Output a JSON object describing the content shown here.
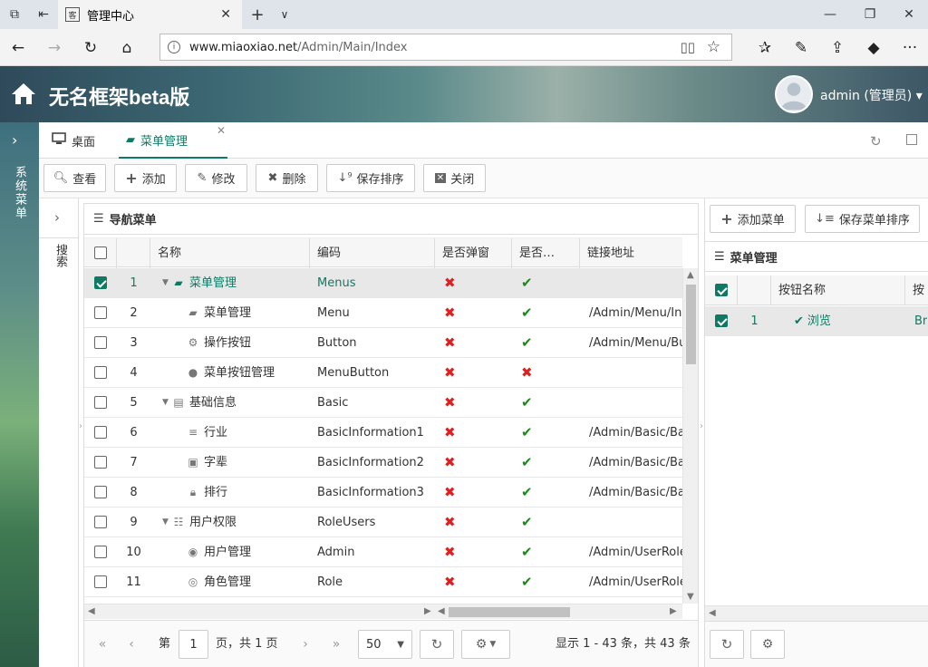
{
  "browser": {
    "tab_title": "管理中心",
    "tab_favicon": "客",
    "url_domain": "www.miaoxiao.net",
    "url_path": "/Admin/Main/Index"
  },
  "app": {
    "title": "无名框架beta版",
    "user": "admin (管理员)"
  },
  "sidebar": {
    "label": "系统菜单"
  },
  "tabs": [
    {
      "label": "桌面"
    },
    {
      "label": "菜单管理"
    }
  ],
  "toolbar": {
    "view": "查看",
    "add": "添加",
    "edit": "修改",
    "delete": "删除",
    "save_order": "保存排序",
    "close": "关闭"
  },
  "search_strip": {
    "label": "搜索"
  },
  "main_panel": {
    "title": "导航菜单",
    "columns": [
      "名称",
      "编码",
      "是否弹窗",
      "是否…",
      "链接地址"
    ],
    "rows": [
      {
        "no": "1",
        "name": "菜单管理",
        "icon": "book-icon",
        "level": 0,
        "expander": true,
        "code": "Menus",
        "popup": false,
        "enabled": true,
        "url": "",
        "selected": true
      },
      {
        "no": "2",
        "name": "菜单管理",
        "icon": "book-icon",
        "level": 1,
        "expander": false,
        "code": "Menu",
        "popup": false,
        "enabled": true,
        "url": "/Admin/Menu/Ind",
        "selected": false
      },
      {
        "no": "3",
        "name": "操作按钮",
        "icon": "cogs-icon",
        "level": 1,
        "expander": false,
        "code": "Button",
        "popup": false,
        "enabled": true,
        "url": "/Admin/Menu/Bu",
        "selected": false
      },
      {
        "no": "4",
        "name": "菜单按钮管理",
        "icon": "user-icon",
        "level": 1,
        "expander": false,
        "code": "MenuButton",
        "popup": false,
        "enabled": false,
        "url": "",
        "selected": false
      },
      {
        "no": "5",
        "name": "基础信息",
        "icon": "list-alt-icon",
        "level": 0,
        "expander": true,
        "code": "Basic",
        "popup": false,
        "enabled": true,
        "url": "",
        "selected": false
      },
      {
        "no": "6",
        "name": "行业",
        "icon": "reorder-icon",
        "level": 1,
        "expander": false,
        "code": "BasicInformation1",
        "popup": false,
        "enabled": true,
        "url": "/Admin/Basic/Ba",
        "selected": false
      },
      {
        "no": "7",
        "name": "字辈",
        "icon": "suitcase-icon",
        "level": 1,
        "expander": false,
        "code": "BasicInformation2",
        "popup": false,
        "enabled": true,
        "url": "/Admin/Basic/Ba",
        "selected": false
      },
      {
        "no": "8",
        "name": "排行",
        "icon": "lock-icon",
        "level": 1,
        "expander": false,
        "code": "BasicInformation3",
        "popup": false,
        "enabled": true,
        "url": "/Admin/Basic/Ba",
        "selected": false
      },
      {
        "no": "9",
        "name": "用户权限",
        "icon": "th-list-icon",
        "level": 0,
        "expander": true,
        "code": "RoleUsers",
        "popup": false,
        "enabled": true,
        "url": "",
        "selected": false
      },
      {
        "no": "10",
        "name": "用户管理",
        "icon": "group-icon",
        "level": 1,
        "expander": false,
        "code": "Admin",
        "popup": false,
        "enabled": true,
        "url": "/Admin/UserRole",
        "selected": false
      },
      {
        "no": "11",
        "name": "角色管理",
        "icon": "user-circle-icon",
        "level": 1,
        "expander": false,
        "code": "Role",
        "popup": false,
        "enabled": true,
        "url": "/Admin/UserRole",
        "selected": false
      }
    ],
    "pager": {
      "page_prefix": "第",
      "page": "1",
      "page_suffix": "页，共 1 页",
      "page_size": "50",
      "summary": "显示 1 - 43 条，共 43 条"
    }
  },
  "right_panel": {
    "add_label": "添加菜单",
    "save_label": "保存菜单排序",
    "title": "菜单管理",
    "columns": [
      "按钮名称",
      "按"
    ],
    "rows": [
      {
        "no": "1",
        "name": "浏览",
        "code": "Br",
        "selected": true
      }
    ]
  },
  "colors": {
    "accent": "#0f7a63",
    "no": "#e02020",
    "yes": "#1a8a1a"
  }
}
